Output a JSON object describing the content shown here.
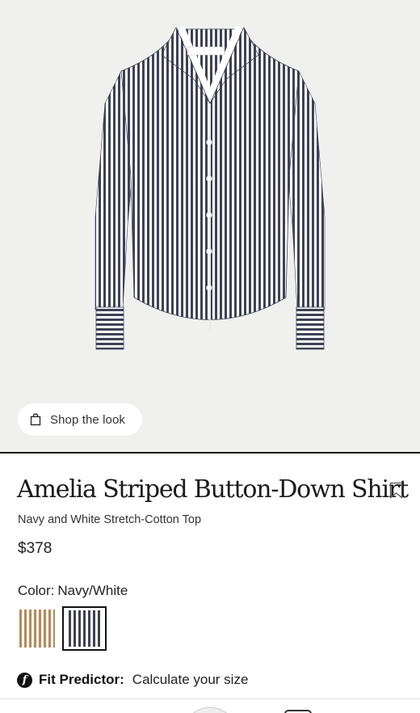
{
  "product": {
    "shop_the_look": "Shop the look",
    "title": "Amelia Striped Button-Down Shirt",
    "subtitle": "Navy and White Stretch-Cotton Top",
    "price": "$378",
    "color_label": "Color:",
    "color_value": "Navy/White",
    "swatches": [
      {
        "name": "Tan/White",
        "color": "#b08c5e"
      },
      {
        "name": "Navy/White",
        "color": "#3e4153",
        "selected": true
      }
    ],
    "label_brand": "VERONICA BEARD",
    "fit_title": "Fit Predictor:",
    "fit_text": "Calculate your size"
  },
  "colors": {
    "background_hero": "#f0f0ef",
    "navy_stripe": "#3e4153",
    "tan_stripe": "#b08c5e"
  }
}
